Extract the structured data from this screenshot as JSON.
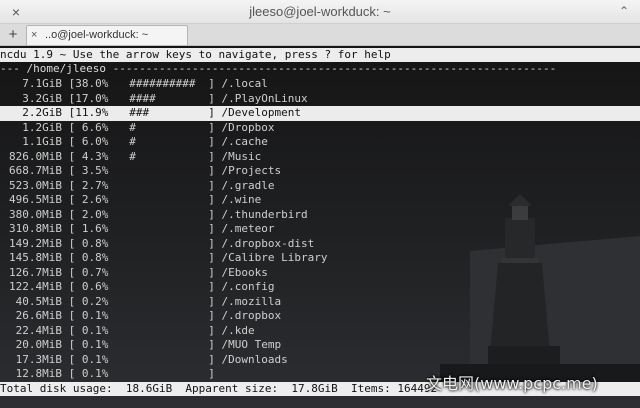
{
  "window": {
    "title": "jleeso@joel-workduck: ~",
    "close_glyph": "×",
    "max_glyph": "⌃"
  },
  "tabs": {
    "add_glyph": "+",
    "items": [
      {
        "close_glyph": "×",
        "label": "..o@joel-workduck: ~"
      }
    ]
  },
  "ncdu": {
    "header": "ncdu 1.9 ~ Use the arrow keys to navigate, press ? for help",
    "path": "--- /home/jleeso -------------------------------------------------------------------",
    "rows": [
      {
        "size": "7.1GiB",
        "percent": "38.0%",
        "bar": "##########",
        "name": "/.local"
      },
      {
        "size": "3.2GiB",
        "percent": "17.0%",
        "bar": "####      ",
        "name": "/.PlayOnLinux"
      },
      {
        "size": "2.2GiB",
        "percent": "11.9%",
        "bar": "###       ",
        "name": "/Development"
      },
      {
        "size": "1.2GiB",
        "percent": " 6.6%",
        "bar": "#         ",
        "name": "/Dropbox"
      },
      {
        "size": "1.1GiB",
        "percent": " 6.0%",
        "bar": "#         ",
        "name": "/.cache"
      },
      {
        "size": "826.0MiB",
        "percent": " 4.3%",
        "bar": "#         ",
        "name": "/Music"
      },
      {
        "size": "668.7MiB",
        "percent": " 3.5%",
        "bar": "          ",
        "name": "/Projects"
      },
      {
        "size": "523.0MiB",
        "percent": " 2.7%",
        "bar": "          ",
        "name": "/.gradle"
      },
      {
        "size": "496.5MiB",
        "percent": " 2.6%",
        "bar": "          ",
        "name": "/.wine"
      },
      {
        "size": "380.0MiB",
        "percent": " 2.0%",
        "bar": "          ",
        "name": "/.thunderbird"
      },
      {
        "size": "310.8MiB",
        "percent": " 1.6%",
        "bar": "          ",
        "name": "/.meteor"
      },
      {
        "size": "149.2MiB",
        "percent": " 0.8%",
        "bar": "          ",
        "name": "/.dropbox-dist"
      },
      {
        "size": "145.8MiB",
        "percent": " 0.8%",
        "bar": "          ",
        "name": "/Calibre Library"
      },
      {
        "size": "126.7MiB",
        "percent": " 0.7%",
        "bar": "          ",
        "name": "/Ebooks"
      },
      {
        "size": "122.4MiB",
        "percent": " 0.6%",
        "bar": "          ",
        "name": "/.config"
      },
      {
        "size": "40.5MiB",
        "percent": " 0.2%",
        "bar": "          ",
        "name": "/.mozilla"
      },
      {
        "size": "26.6MiB",
        "percent": " 0.1%",
        "bar": "          ",
        "name": "/.dropbox"
      },
      {
        "size": "22.4MiB",
        "percent": " 0.1%",
        "bar": "          ",
        "name": "/.kde"
      },
      {
        "size": "20.0MiB",
        "percent": " 0.1%",
        "bar": "          ",
        "name": "/MUO Temp"
      },
      {
        "size": "17.3MiB",
        "percent": " 0.1%",
        "bar": "          ",
        "name": "/Downloads"
      },
      {
        "size": "12.8MiB",
        "percent": " 0.1%",
        "bar": "          ",
        "name": ""
      }
    ],
    "selected_row": 2,
    "status": "Total disk usage:  18.6GiB  Apparent size:  17.8GiB  Items: 164492"
  },
  "watermark": "文电网(www.pcpc.me)",
  "colors": {
    "titlebar": "#ececec",
    "terminal_bg": "#1e1f21",
    "terminal_fg": "#d0d0d0",
    "highlight_bg": "#ececec"
  }
}
